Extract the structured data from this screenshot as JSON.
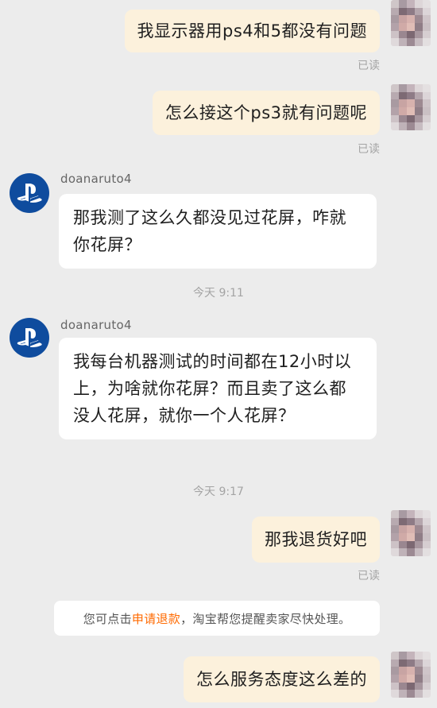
{
  "messages": {
    "m1": {
      "text": "我显示器用ps4和5都没有问题",
      "read": "已读"
    },
    "m2": {
      "text": "怎么接这个ps3就有问题呢",
      "read": "已读"
    },
    "m3": {
      "sender": "doanaruto4",
      "text": "那我测了这么久都没见过花屏，咋就你花屏？"
    },
    "m4": {
      "sender": "doanaruto4",
      "text": "我每台机器测试的时间都在12小时以上，为啥就你花屏？而且卖了这么都没人花屏，就你一个人花屏？"
    },
    "m5": {
      "text": "那我退货好吧",
      "read": "已读"
    },
    "m6": {
      "text": "怎么服务态度这么差的"
    }
  },
  "timestamps": {
    "t1": "今天 9:11",
    "t2": "今天 9:17"
  },
  "notice": {
    "prefix": "您可点击",
    "link": "申请退款",
    "suffix": "，淘宝帮您提醒卖家尽快处理。"
  },
  "colors": {
    "background": "#ececec",
    "outgoing_bubble": "#fcf1dc",
    "incoming_bubble": "#ffffff",
    "link": "#ff6a00",
    "seller_avatar": "#0f4c9e"
  },
  "icons": {
    "seller_avatar": "playstation-logo-icon",
    "user_avatar": "pixelated-avatar"
  }
}
